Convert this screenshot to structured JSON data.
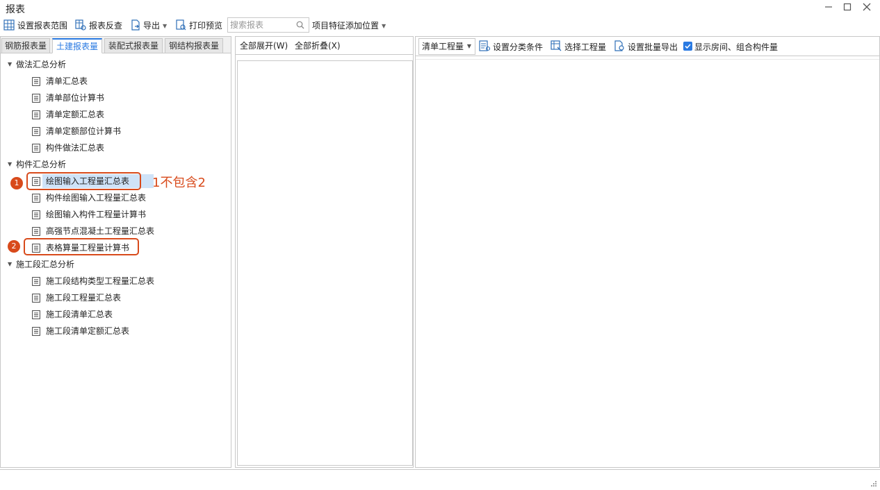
{
  "window": {
    "title": "报表"
  },
  "toolbar": {
    "set_range": "设置报表范围",
    "reverse_check": "报表反查",
    "export": "导出",
    "print_preview": "打印预览",
    "search_placeholder": "搜索报表",
    "feature_position": "项目特征添加位置"
  },
  "tabs": [
    {
      "label": "钢筋报表量",
      "active": false
    },
    {
      "label": "土建报表量",
      "active": true
    },
    {
      "label": "装配式报表量",
      "active": false
    },
    {
      "label": "钢结构报表量",
      "active": false
    }
  ],
  "tree": {
    "groups": [
      {
        "label": "做法汇总分析",
        "items": [
          "清单汇总表",
          "清单部位计算书",
          "清单定额汇总表",
          "清单定额部位计算书",
          "构件做法汇总表"
        ]
      },
      {
        "label": "构件汇总分析",
        "items": [
          "绘图输入工程量汇总表",
          "构件绘图输入工程量汇总表",
          "绘图输入构件工程量计算书",
          "高强节点混凝土工程量汇总表",
          "表格算量工程量计算书"
        ]
      },
      {
        "label": "施工段汇总分析",
        "items": [
          "施工段结构类型工程量汇总表",
          "施工段工程量汇总表",
          "施工段清单汇总表",
          "施工段清单定额汇总表"
        ]
      }
    ],
    "selected": "绘图输入工程量汇总表"
  },
  "annotations": {
    "badge1": "1",
    "badge2": "2",
    "note": "1不包含2",
    "color": "#d84a1b"
  },
  "mid": {
    "expand_all": "全部展开(W)",
    "collapse_all": "全部折叠(X)"
  },
  "right": {
    "quantity_type": "清单工程量",
    "set_category": "设置分类条件",
    "select_quantity": "选择工程量",
    "batch_export": "设置批量导出",
    "show_rooms_label": "显示房间、组合构件量",
    "show_rooms_checked": true
  },
  "colors": {
    "accent": "#2a7ae2",
    "selection": "#cfe3f8",
    "annotation": "#d84a1b"
  }
}
